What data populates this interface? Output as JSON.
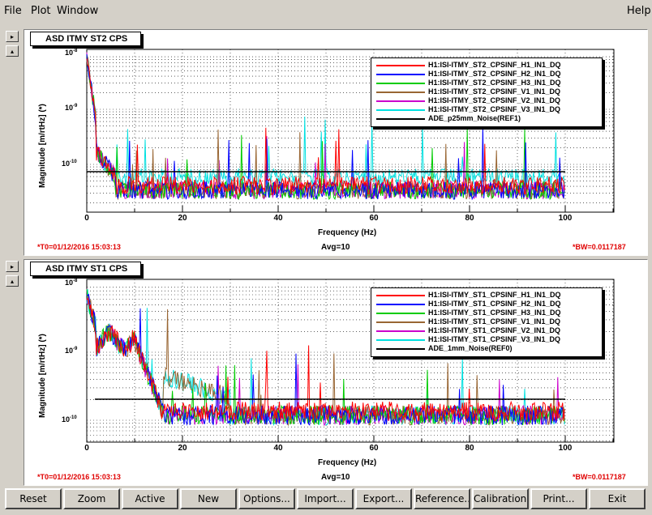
{
  "menu": {
    "file": "File",
    "plot": "Plot",
    "window": "Window",
    "help": "Help"
  },
  "side_buttons": {
    "right": "▸",
    "up": "▴"
  },
  "panels": [
    {
      "title": "ASD ITMY ST2 CPS",
      "ylabel": "Magnitude [m/rtHz] (*)",
      "xlabel": "Frequency (Hz)",
      "t0": "*T0=01/12/2016 15:03:13",
      "avg": "Avg=10",
      "bw": "*BW=0.0117187",
      "yticks": [
        {
          "base": "10",
          "exp": "-8"
        },
        {
          "base": "10",
          "exp": "-9"
        },
        {
          "base": "10",
          "exp": "-10"
        }
      ],
      "xticks": [
        "0",
        "20",
        "40",
        "60",
        "80",
        "100"
      ],
      "legend": [
        {
          "label": "H1:ISI-ITMY_ST2_CPSINF_H1_IN1_DQ",
          "color": "#ff0000"
        },
        {
          "label": "H1:ISI-ITMY_ST2_CPSINF_H2_IN1_DQ",
          "color": "#0000ff"
        },
        {
          "label": "H1:ISI-ITMY_ST2_CPSINF_H3_IN1_DQ",
          "color": "#00cc00"
        },
        {
          "label": "H1:ISI-ITMY_ST2_CPSINF_V1_IN1_DQ",
          "color": "#996633"
        },
        {
          "label": "H1:ISI-ITMY_ST2_CPSINF_V2_IN1_DQ",
          "color": "#cc00cc"
        },
        {
          "label": "H1:ISI-ITMY_ST2_CPSINF_V3_IN1_DQ",
          "color": "#00e0e0"
        },
        {
          "label": "ADE_p25mm_Noise(REF1)",
          "color": "#000000"
        }
      ]
    },
    {
      "title": "ASD ITMY ST1 CPS",
      "ylabel": "Magnitude [m/rtHz] (*)",
      "xlabel": "Frequency (Hz)",
      "t0": "*T0=01/12/2016 15:03:13",
      "avg": "Avg=10",
      "bw": "*BW=0.0117187",
      "yticks": [
        {
          "base": "10",
          "exp": "-8"
        },
        {
          "base": "10",
          "exp": "-9"
        },
        {
          "base": "10",
          "exp": "-10"
        }
      ],
      "xticks": [
        "0",
        "20",
        "40",
        "60",
        "80",
        "100"
      ],
      "legend": [
        {
          "label": "H1:ISI-ITMY_ST1_CPSINF_H1_IN1_DQ",
          "color": "#ff0000"
        },
        {
          "label": "H1:ISI-ITMY_ST1_CPSINF_H2_IN1_DQ",
          "color": "#0000ff"
        },
        {
          "label": "H1:ISI-ITMY_ST1_CPSINF_H3_IN1_DQ",
          "color": "#00cc00"
        },
        {
          "label": "H1:ISI-ITMY_ST1_CPSINF_V1_IN1_DQ",
          "color": "#996633"
        },
        {
          "label": "H1:ISI-ITMY_ST1_CPSINF_V2_IN1_DQ",
          "color": "#cc00cc"
        },
        {
          "label": "H1:ISI-ITMY_ST1_CPSINF_V3_IN1_DQ",
          "color": "#00e0e0"
        },
        {
          "label": "ADE_1mm_Noise(REF0)",
          "color": "#000000"
        }
      ]
    }
  ],
  "buttons": [
    "Reset",
    "Zoom",
    "Active",
    "New",
    "Options...",
    "Import...",
    "Export...",
    "Reference...",
    "Calibration...",
    "Print...",
    "Exit"
  ]
}
